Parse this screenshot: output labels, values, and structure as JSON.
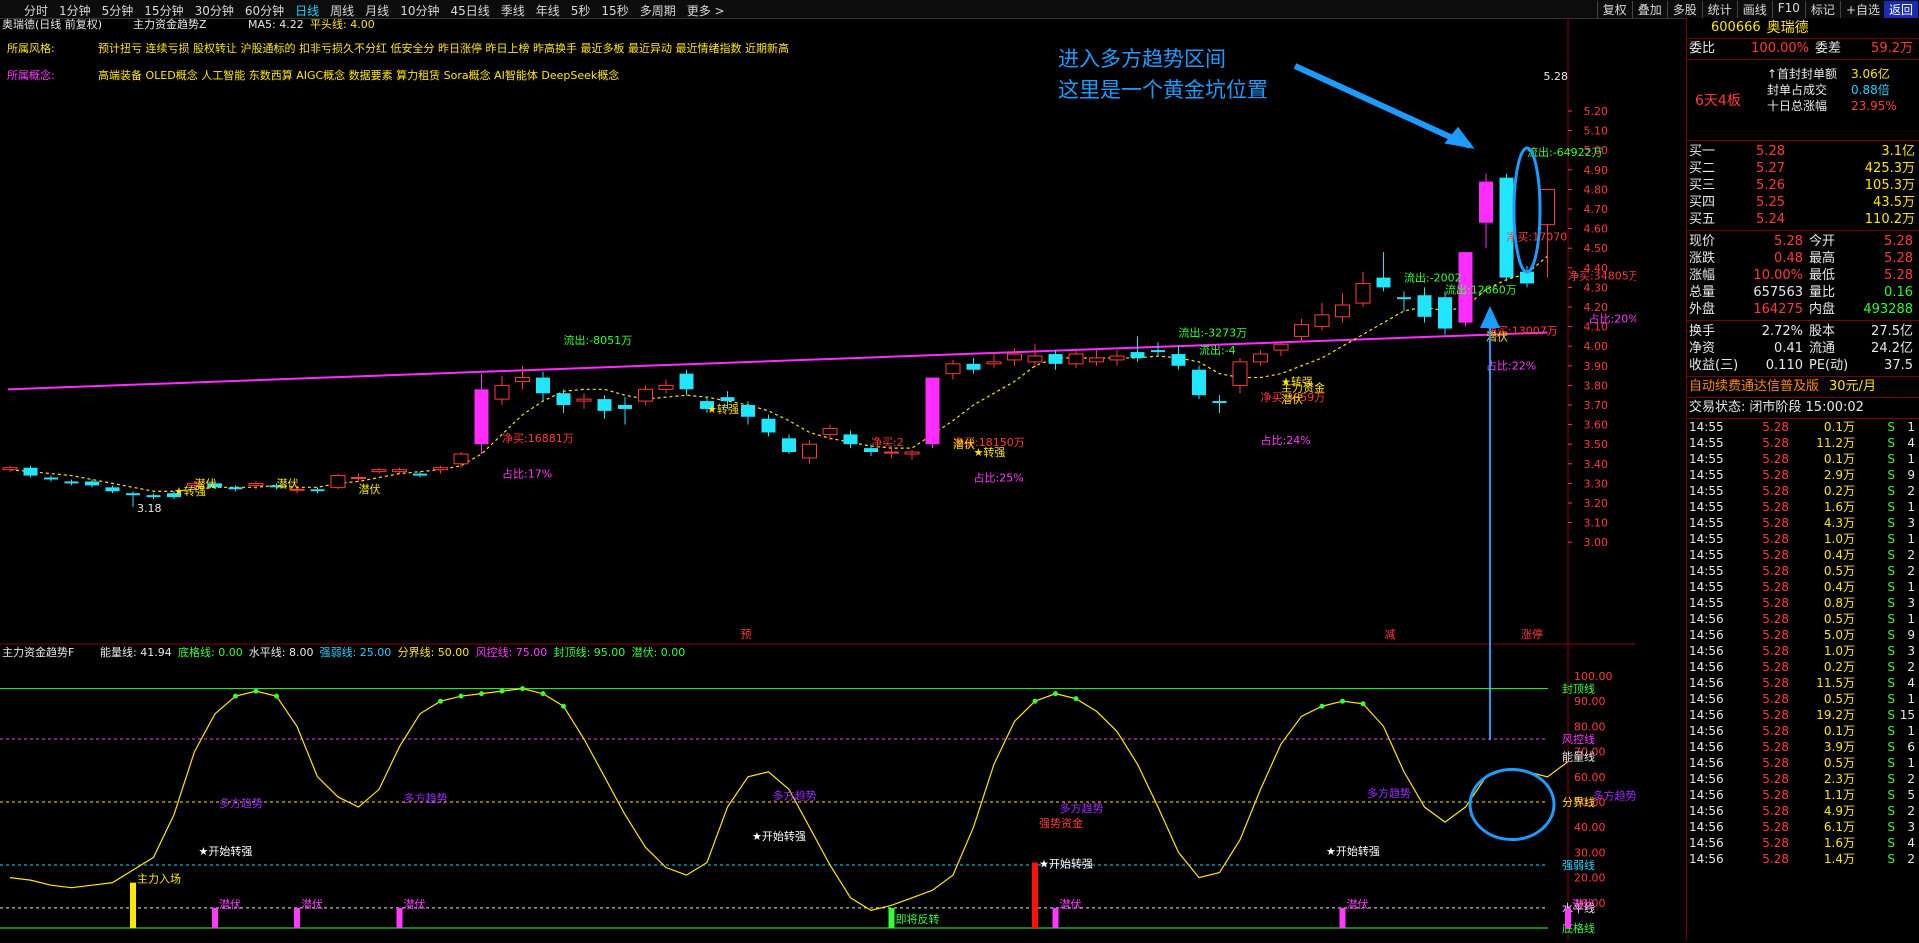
{
  "toolbar": {
    "tabs": [
      "分时",
      "1分钟",
      "5分钟",
      "15分钟",
      "30分钟",
      "60分钟",
      "日线",
      "周线",
      "月线",
      "10分钟",
      "45日线",
      "季线",
      "年线",
      "5秒",
      "15秒",
      "多周期",
      "更多 >"
    ],
    "active_tab": "日线",
    "right_buttons": [
      "复权",
      "叠加",
      "多股",
      "统计",
      "画线",
      "F10",
      "标记",
      "+自选"
    ],
    "back_button": "返回"
  },
  "main_header": {
    "stock": "奥瑞德(日线 前复权)",
    "indicator": "主力资金趋势Z",
    "ma5": "MA5: 4.22",
    "pingtou": "平头线: 4.00"
  },
  "style_row": {
    "label": "所属风格:",
    "text": "预计扭亏 连续亏损 股权转让 沪股通标的 扣非亏损久不分红 低安全分 昨日涨停 昨日上榜 昨高换手 最近多板 最近异动 最近情绪指数 近期新高"
  },
  "concept_row": {
    "label": "所属概念:",
    "text": "高端装备 OLED概念 人工智能 东数西算 AIGC概念 数据要素 算力租赁 Sora概念 AI智能体 DeepSeek概念"
  },
  "annotation": {
    "line1": "进入多方趋势区间",
    "line2": "这里是一个黄金坑位置"
  },
  "price_axis": [
    "5.20",
    "5.10",
    "5.00",
    "4.90",
    "4.80",
    "4.70",
    "4.60",
    "4.50",
    "4.40",
    "4.30",
    "4.20",
    "4.10",
    "4.00",
    "3.90",
    "3.80",
    "3.70",
    "3.60",
    "3.50",
    "3.40",
    "3.30",
    "3.20",
    "3.10",
    "3.00"
  ],
  "price_marks": {
    "high": "5.28",
    "low": "3.18"
  },
  "candles": [
    [
      3.37,
      3.38,
      3.39,
      3.36
    ],
    [
      3.38,
      3.34,
      3.39,
      3.33
    ],
    [
      3.33,
      3.32,
      3.34,
      3.31
    ],
    [
      3.31,
      3.3,
      3.32,
      3.29
    ],
    [
      3.31,
      3.29,
      3.32,
      3.28
    ],
    [
      3.28,
      3.26,
      3.29,
      3.25
    ],
    [
      3.25,
      3.24,
      3.26,
      3.18
    ],
    [
      3.24,
      3.23,
      3.25,
      3.22
    ],
    [
      3.25,
      3.23,
      3.26,
      3.22
    ],
    [
      3.29,
      3.3,
      3.31,
      3.27
    ],
    [
      3.3,
      3.28,
      3.31,
      3.27
    ],
    [
      3.28,
      3.27,
      3.29,
      3.26
    ],
    [
      3.29,
      3.3,
      3.31,
      3.27
    ],
    [
      3.29,
      3.28,
      3.3,
      3.27
    ],
    [
      3.27,
      3.27,
      3.29,
      3.25
    ],
    [
      3.27,
      3.26,
      3.28,
      3.25
    ],
    [
      3.28,
      3.34,
      3.35,
      3.27
    ],
    [
      3.33,
      3.33,
      3.35,
      3.31
    ],
    [
      3.36,
      3.37,
      3.38,
      3.35
    ],
    [
      3.36,
      3.37,
      3.38,
      3.35
    ],
    [
      3.35,
      3.34,
      3.36,
      3.33
    ],
    [
      3.37,
      3.38,
      3.39,
      3.35
    ],
    [
      3.4,
      3.45,
      3.46,
      3.38
    ],
    [
      3.5,
      3.78,
      3.86,
      3.45
    ],
    [
      3.73,
      3.8,
      3.85,
      3.7
    ],
    [
      3.82,
      3.84,
      3.9,
      3.78
    ],
    [
      3.84,
      3.76,
      3.87,
      3.72
    ],
    [
      3.76,
      3.7,
      3.78,
      3.66
    ],
    [
      3.72,
      3.73,
      3.76,
      3.68
    ],
    [
      3.73,
      3.67,
      3.75,
      3.63
    ],
    [
      3.7,
      3.68,
      3.74,
      3.6
    ],
    [
      3.72,
      3.78,
      3.8,
      3.7
    ],
    [
      3.78,
      3.8,
      3.83,
      3.76
    ],
    [
      3.86,
      3.78,
      3.88,
      3.75
    ],
    [
      3.72,
      3.68,
      3.74,
      3.66
    ],
    [
      3.74,
      3.72,
      3.77,
      3.68
    ],
    [
      3.7,
      3.64,
      3.72,
      3.6
    ],
    [
      3.63,
      3.56,
      3.65,
      3.54
    ],
    [
      3.53,
      3.46,
      3.55,
      3.45
    ],
    [
      3.43,
      3.5,
      3.52,
      3.4
    ],
    [
      3.55,
      3.58,
      3.6,
      3.52
    ],
    [
      3.55,
      3.5,
      3.57,
      3.48
    ],
    [
      3.48,
      3.46,
      3.5,
      3.44
    ],
    [
      3.46,
      3.46,
      3.48,
      3.43
    ],
    [
      3.45,
      3.46,
      3.47,
      3.42
    ],
    [
      3.5,
      3.84,
      3.84,
      3.48
    ],
    [
      3.86,
      3.91,
      3.93,
      3.83
    ],
    [
      3.91,
      3.88,
      3.94,
      3.86
    ],
    [
      3.91,
      3.92,
      3.97,
      3.89
    ],
    [
      3.93,
      3.96,
      3.99,
      3.9
    ],
    [
      3.92,
      3.95,
      4.01,
      3.89
    ],
    [
      3.96,
      3.91,
      3.98,
      3.88
    ],
    [
      3.91,
      3.96,
      3.98,
      3.89
    ],
    [
      3.92,
      3.94,
      3.98,
      3.9
    ],
    [
      3.93,
      3.95,
      3.98,
      3.9
    ],
    [
      3.97,
      3.94,
      4.05,
      3.92
    ],
    [
      3.98,
      3.97,
      4.02,
      3.95
    ],
    [
      3.96,
      3.9,
      4.0,
      3.88
    ],
    [
      3.88,
      3.75,
      3.9,
      3.73
    ],
    [
      3.72,
      3.71,
      3.75,
      3.66
    ],
    [
      3.8,
      3.92,
      3.94,
      3.76
    ],
    [
      3.92,
      3.96,
      3.98,
      3.9
    ],
    [
      3.98,
      4.01,
      4.02,
      3.95
    ],
    [
      4.05,
      4.11,
      4.14,
      4.02
    ],
    [
      4.1,
      4.16,
      4.22,
      4.08
    ],
    [
      4.15,
      4.21,
      4.27,
      4.12
    ],
    [
      4.22,
      4.32,
      4.38,
      4.2
    ],
    [
      4.35,
      4.3,
      4.48,
      4.28
    ],
    [
      4.25,
      4.24,
      4.28,
      4.18
    ],
    [
      4.26,
      4.15,
      4.3,
      4.12
    ],
    [
      4.25,
      4.09,
      4.28,
      4.06
    ],
    [
      4.12,
      4.48,
      4.48,
      4.1
    ],
    [
      4.63,
      4.84,
      4.88,
      4.5
    ],
    [
      4.86,
      4.35,
      4.88,
      4.33
    ],
    [
      4.38,
      4.32,
      4.41,
      4.3
    ],
    [
      4.62,
      4.8,
      4.8,
      4.35
    ]
  ],
  "ma5": [
    3.37,
    3.36,
    3.35,
    3.34,
    3.32,
    3.3,
    3.28,
    3.26,
    3.26,
    3.27,
    3.28,
    3.28,
    3.28,
    3.29,
    3.28,
    3.28,
    3.3,
    3.31,
    3.33,
    3.35,
    3.36,
    3.37,
    3.39,
    3.45,
    3.55,
    3.65,
    3.72,
    3.77,
    3.78,
    3.78,
    3.75,
    3.73,
    3.74,
    3.75,
    3.74,
    3.72,
    3.7,
    3.67,
    3.62,
    3.56,
    3.53,
    3.51,
    3.49,
    3.48,
    3.48,
    3.55,
    3.62,
    3.7,
    3.76,
    3.82,
    3.9,
    3.94,
    3.94,
    3.94,
    3.94,
    3.94,
    3.95,
    3.94,
    3.92,
    3.86,
    3.84,
    3.84,
    3.86,
    3.9,
    3.94,
    4.0,
    4.06,
    4.12,
    4.18,
    4.2,
    4.18,
    4.2,
    4.29,
    4.34,
    4.37,
    4.46
  ],
  "ma_long": [
    3.78,
    3.79,
    3.8,
    3.81,
    3.82,
    3.83,
    3.84,
    3.85,
    3.86,
    3.87,
    3.88,
    3.89,
    3.9,
    3.91,
    3.92,
    3.93,
    3.94,
    3.95,
    3.96,
    3.97,
    3.98,
    3.99,
    4.0,
    4.01,
    4.02,
    4.03,
    4.04,
    4.05,
    4.06,
    4.07
  ],
  "chart_labels": [
    {
      "text": "流出:-8051万",
      "color": "#35ff35",
      "i": 27,
      "p": 4.01
    },
    {
      "text": "净买:16881万",
      "color": "#ff3b3b",
      "i": 24,
      "p": 3.51
    },
    {
      "text": "占比:17%",
      "color": "#ff3bff",
      "i": 24,
      "p": 3.33
    },
    {
      "text": "★转强",
      "color": "#ffe600",
      "i": 8,
      "p": 3.24
    },
    {
      "text": "潜伏",
      "color": "#ffe600",
      "i": 9,
      "p": 3.28
    },
    {
      "text": "潜伏",
      "color": "#ffe600",
      "i": 13,
      "p": 3.28
    },
    {
      "text": "潜伏",
      "color": "#ffe600",
      "i": 17,
      "p": 3.25
    },
    {
      "text": "★转强",
      "color": "#ffe600",
      "i": 34,
      "p": 3.66
    },
    {
      "text": "净买:2",
      "color": "#ff3b3b",
      "i": 42,
      "p": 3.49
    },
    {
      "text": "净买:18150万",
      "color": "#ff3b3b",
      "i": 46,
      "p": 3.49
    },
    {
      "text": "潜伏",
      "color": "#ffe600",
      "i": 46,
      "p": 3.48
    },
    {
      "text": "★转强",
      "color": "#ffe600",
      "i": 47,
      "p": 3.44
    },
    {
      "text": "占比:25%",
      "color": "#ff3bff",
      "i": 47,
      "p": 3.31
    },
    {
      "text": "流出:-3273万",
      "color": "#35ff35",
      "i": 57,
      "p": 4.05
    },
    {
      "text": "流出:-4",
      "color": "#35ff35",
      "i": 58,
      "p": 3.96
    },
    {
      "text": "★转强",
      "color": "#ffe600",
      "i": 62,
      "p": 3.8
    },
    {
      "text": "主力资金",
      "color": "#ffe600",
      "i": 62,
      "p": 3.77
    },
    {
      "text": "净买:3859万",
      "color": "#ff3b3b",
      "i": 61,
      "p": 3.72
    },
    {
      "text": "潜伏",
      "color": "#ffe600",
      "i": 62,
      "p": 3.71
    },
    {
      "text": "占比:24%",
      "color": "#ff3bff",
      "i": 61,
      "p": 3.5
    },
    {
      "text": "流出:-2002",
      "color": "#35ff35",
      "i": 68,
      "p": 4.33
    },
    {
      "text": "流出:12660万",
      "color": "#35ff35",
      "i": 70,
      "p": 4.27
    },
    {
      "text": "净买:13007万",
      "color": "#ff3b3b",
      "i": 72,
      "p": 4.06
    },
    {
      "text": "潜伏",
      "color": "#ffe600",
      "i": 72,
      "p": 4.03
    },
    {
      "text": "占比:22%",
      "color": "#ff3bff",
      "i": 72,
      "p": 3.88
    },
    {
      "text": "流出:-64922万",
      "color": "#35ff35",
      "i": 74,
      "p": 4.97
    },
    {
      "text": "净买:17070",
      "color": "#ff3b3b",
      "i": 73,
      "p": 4.54
    },
    {
      "text": "净买:34805万",
      "color": "#ff3b3b",
      "i": 76,
      "p": 4.34
    },
    {
      "text": "占比:20%",
      "color": "#ff3bff",
      "i": 77,
      "p": 4.12
    }
  ],
  "date_markers": [
    "预",
    "减",
    "涨停"
  ],
  "indicator": {
    "title": "主力资金趋势F",
    "values": [
      {
        "label": "能量线: 41.94",
        "color": "#e8e8e8"
      },
      {
        "label": "底格线: 0.00",
        "color": "#35ff35"
      },
      {
        "label": "水平线: 8.00",
        "color": "#e8e8e8"
      },
      {
        "label": "强弱线: 25.00",
        "color": "#22d3ff"
      },
      {
        "label": "分界线: 50.00",
        "color": "#ffe600"
      },
      {
        "label": "风控线: 75.00",
        "color": "#ff3bff"
      },
      {
        "label": "封顶线: 95.00",
        "color": "#35ff35"
      },
      {
        "label": "潜伏: 0.00",
        "color": "#35ff35"
      }
    ],
    "axis": [
      "100.00",
      "90.00",
      "80.00",
      "70.00",
      "60.00",
      "50.00",
      "40.00",
      "30.00",
      "20.00",
      "10.00"
    ],
    "line_names": [
      "封顶线",
      "风控线",
      "能量线",
      "分界线",
      "强弱线",
      "水平线",
      "底格线"
    ],
    "curve": [
      20,
      19,
      17,
      16,
      17,
      18,
      23,
      28,
      45,
      70,
      85,
      92,
      94,
      92,
      80,
      60,
      52,
      48,
      55,
      72,
      85,
      90,
      92,
      93,
      94,
      95,
      93,
      88,
      75,
      60,
      45,
      32,
      24,
      21,
      26,
      48,
      60,
      62,
      55,
      40,
      25,
      12,
      7,
      9,
      12,
      15,
      21,
      40,
      65,
      82,
      90,
      93,
      91,
      86,
      78,
      65,
      48,
      30,
      20,
      22,
      35,
      55,
      73,
      84,
      88,
      90,
      89,
      80,
      62,
      48,
      42,
      48,
      60,
      63,
      62,
      60,
      66
    ],
    "labels": [
      {
        "text": "主力入场",
        "color": "#ffe600",
        "i": 6,
        "v": 18
      },
      {
        "text": "★开始转强",
        "color": "#ffffff",
        "i": 9,
        "v": 29
      },
      {
        "text": "多方趋势",
        "color": "#a02cff",
        "i": 10,
        "v": 48
      },
      {
        "text": "多方趋势",
        "color": "#a02cff",
        "i": 19,
        "v": 50
      },
      {
        "text": "★开始转强",
        "color": "#ffffff",
        "i": 36,
        "v": 35
      },
      {
        "text": "多方趋势",
        "color": "#a02cff",
        "i": 37,
        "v": 51
      },
      {
        "text": "即将反转",
        "color": "#35ff35",
        "i": 43,
        "v": 2
      },
      {
        "text": "强势资金",
        "color": "#ff3b3b",
        "i": 50,
        "v": 40
      },
      {
        "text": "★开始转强",
        "color": "#ffffff",
        "i": 50,
        "v": 24
      },
      {
        "text": "多方趋势",
        "color": "#a02cff",
        "i": 51,
        "v": 46
      },
      {
        "text": "★开始转强",
        "color": "#ffffff",
        "i": 64,
        "v": 29
      },
      {
        "text": "多方趋势",
        "color": "#a02cff",
        "i": 66,
        "v": 52
      },
      {
        "text": "多方趋势",
        "color": "#a02cff",
        "i": 77,
        "v": 51
      },
      {
        "text": "潜伏",
        "color": "#ff3bff",
        "i": 10,
        "v": 8
      },
      {
        "text": "潜伏",
        "color": "#ff3bff",
        "i": 14,
        "v": 8
      },
      {
        "text": "潜伏",
        "color": "#ff3bff",
        "i": 19,
        "v": 8
      },
      {
        "text": "潜伏",
        "color": "#ff3bff",
        "i": 51,
        "v": 8
      },
      {
        "text": "潜伏",
        "color": "#ff3bff",
        "i": 65,
        "v": 8
      },
      {
        "text": "潜伏",
        "color": "#ff3bff",
        "i": 76,
        "v": 8
      }
    ]
  },
  "side": {
    "code": "600666",
    "name": "奥瑞德",
    "weibi_label": "委比",
    "weibi": "100.00%",
    "weicha_label": "委差",
    "weicha": "59.2万",
    "board": "6天4板",
    "stats": [
      {
        "k": "↑首封封单额",
        "v": "3.06亿"
      },
      {
        "k": "封单占成交",
        "v": "0.88倍"
      },
      {
        "k": "十日总涨幅",
        "v": "23.95%"
      }
    ],
    "buys": [
      {
        "k": "买一",
        "p": "5.28",
        "v": "3.1亿"
      },
      {
        "k": "买二",
        "p": "5.27",
        "v": "425.3万"
      },
      {
        "k": "买三",
        "p": "5.26",
        "v": "105.3万"
      },
      {
        "k": "买四",
        "p": "5.25",
        "v": "43.5万"
      },
      {
        "k": "买五",
        "p": "5.24",
        "v": "110.2万"
      }
    ],
    "quote": [
      {
        "k1": "现价",
        "v1": "5.28",
        "c1": "red",
        "k2": "今开",
        "v2": "5.28",
        "c2": "red"
      },
      {
        "k1": "涨跌",
        "v1": "0.48",
        "c1": "red",
        "k2": "最高",
        "v2": "5.28",
        "c2": "red"
      },
      {
        "k1": "涨幅",
        "v1": "10.00%",
        "c1": "red",
        "k2": "最低",
        "v2": "5.28",
        "c2": "red"
      },
      {
        "k1": "总量",
        "v1": "657563",
        "c1": "white",
        "k2": "量比",
        "v2": "0.16",
        "c2": "green"
      },
      {
        "k1": "外盘",
        "v1": "164275",
        "c1": "red",
        "k2": "内盘",
        "v2": "493288",
        "c2": "green"
      }
    ],
    "fund": [
      {
        "k1": "换手",
        "v1": "2.72%",
        "k2": "股本",
        "v2": "27.5亿"
      },
      {
        "k1": "净资",
        "v1": "0.41",
        "k2": "流通",
        "v2": "24.2亿"
      },
      {
        "k1": "收益(三)",
        "v1": "0.110",
        "k2": "PE(动)",
        "v2": "37.5"
      }
    ],
    "promo": "自动续费通达信普及版",
    "promo_price": "30元/月",
    "state_label": "交易状态:",
    "state": "闭市阶段 15:00:02",
    "ticks": [
      [
        "14:55",
        "5.28",
        "0.1万",
        "S",
        "1"
      ],
      [
        "14:55",
        "5.28",
        "11.2万",
        "S",
        "4"
      ],
      [
        "14:55",
        "5.28",
        "0.1万",
        "S",
        "1"
      ],
      [
        "14:55",
        "5.28",
        "2.9万",
        "S",
        "9"
      ],
      [
        "14:55",
        "5.28",
        "0.2万",
        "S",
        "2"
      ],
      [
        "14:55",
        "5.28",
        "1.6万",
        "S",
        "1"
      ],
      [
        "14:55",
        "5.28",
        "4.3万",
        "S",
        "3"
      ],
      [
        "14:55",
        "5.28",
        "1.0万",
        "S",
        "1"
      ],
      [
        "14:55",
        "5.28",
        "0.4万",
        "S",
        "2"
      ],
      [
        "14:55",
        "5.28",
        "0.5万",
        "S",
        "2"
      ],
      [
        "14:55",
        "5.28",
        "0.4万",
        "S",
        "1"
      ],
      [
        "14:55",
        "5.28",
        "0.8万",
        "S",
        "3"
      ],
      [
        "14:56",
        "5.28",
        "0.5万",
        "S",
        "1"
      ],
      [
        "14:56",
        "5.28",
        "5.0万",
        "S",
        "9"
      ],
      [
        "14:56",
        "5.28",
        "1.0万",
        "S",
        "3"
      ],
      [
        "14:56",
        "5.28",
        "0.2万",
        "S",
        "2"
      ],
      [
        "14:56",
        "5.28",
        "11.5万",
        "S",
        "4"
      ],
      [
        "14:56",
        "5.28",
        "0.5万",
        "S",
        "1"
      ],
      [
        "14:56",
        "5.28",
        "19.2万",
        "S",
        "15"
      ],
      [
        "14:56",
        "5.28",
        "0.1万",
        "S",
        "1"
      ],
      [
        "14:56",
        "5.28",
        "3.9万",
        "S",
        "6"
      ],
      [
        "14:56",
        "5.28",
        "0.5万",
        "S",
        "1"
      ],
      [
        "14:56",
        "5.28",
        "2.3万",
        "S",
        "2"
      ],
      [
        "14:56",
        "5.28",
        "1.1万",
        "S",
        "5"
      ],
      [
        "14:56",
        "5.28",
        "4.9万",
        "S",
        "2"
      ],
      [
        "14:56",
        "5.28",
        "6.1万",
        "S",
        "3"
      ],
      [
        "14:56",
        "5.28",
        "1.6万",
        "S",
        "4"
      ],
      [
        "14:56",
        "5.28",
        "1.4万",
        "S",
        "2"
      ]
    ]
  },
  "colors": {
    "up": "#ff3b3b",
    "down": "#22e6ff",
    "magenta": "#ff2cff",
    "ma5": "#ffe600",
    "annotation": "#1e9bff"
  }
}
